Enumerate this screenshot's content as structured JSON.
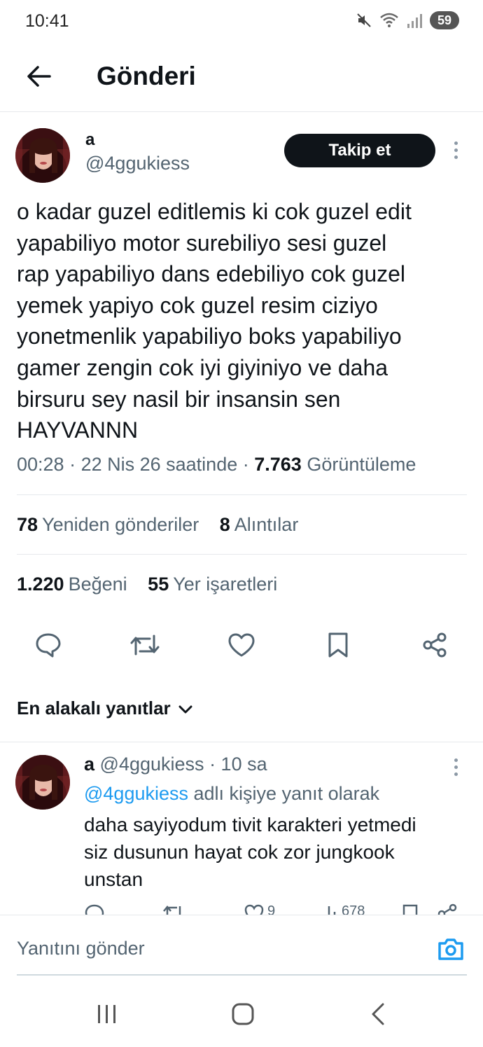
{
  "status_bar": {
    "time": "10:41",
    "battery": "59",
    "icons": [
      "mute-icon",
      "wifi-icon",
      "signal-icon",
      "battery-icon"
    ]
  },
  "header": {
    "title": "Gönderi",
    "back_icon": "arrow-left-icon"
  },
  "tweet": {
    "author_name": "a",
    "author_handle": "@4ggukiess",
    "follow_label": "Takip et",
    "text": "o kadar guzel editlemis ki cok guzel edit\nyapabiliyo motor surebiliyo sesi guzel\nrap yapabiliyo dans edebiliyo cok guzel\nyemek yapiyo cok guzel resim ciziyo\nyonetmenlik yapabiliyo boks yapabiliyo\ngamer zengin cok iyi giyiniyo ve daha\nbirsuru sey nasil bir insansin sen\nHAYVANNN",
    "time": "00:28",
    "date": "22 Nis 26 saatinde",
    "views": "7.763",
    "views_label": "Görüntüleme",
    "sep1": " · ",
    "sep2": " · "
  },
  "stats": {
    "retweets": "78",
    "retweets_label": "Yeniden gönderiler",
    "quotes": "8",
    "quotes_label": "Alıntılar",
    "likes": "1.220",
    "likes_label": "Beğeni",
    "bookmarks": "55",
    "bookmarks_label": "Yer işaretleri"
  },
  "actions": [
    "reply-icon",
    "retweet-icon",
    "like-icon",
    "bookmark-icon",
    "share-icon"
  ],
  "sort_label": "En alakalı yanıtlar",
  "reply": {
    "author_name": "a",
    "author_handle": "@4ggukiess",
    "time_ago": "· 10 sa",
    "replying_mention": "@4ggukiess",
    "replying_suffix": "adlı kişiye yanıt olarak",
    "text": "daha sayiyodum tivit karakteri yetmedi\nsiz dusunun hayat cok zor jungkook\nunstan",
    "likes": "9",
    "views": "678"
  },
  "composer": {
    "placeholder": "Yanıtını gönder",
    "camera_icon": "camera-icon"
  },
  "colors": {
    "accent": "#1d9bf0",
    "text_primary": "#0f1419",
    "text_secondary": "#536471",
    "follow_bg": "#0f1419"
  }
}
